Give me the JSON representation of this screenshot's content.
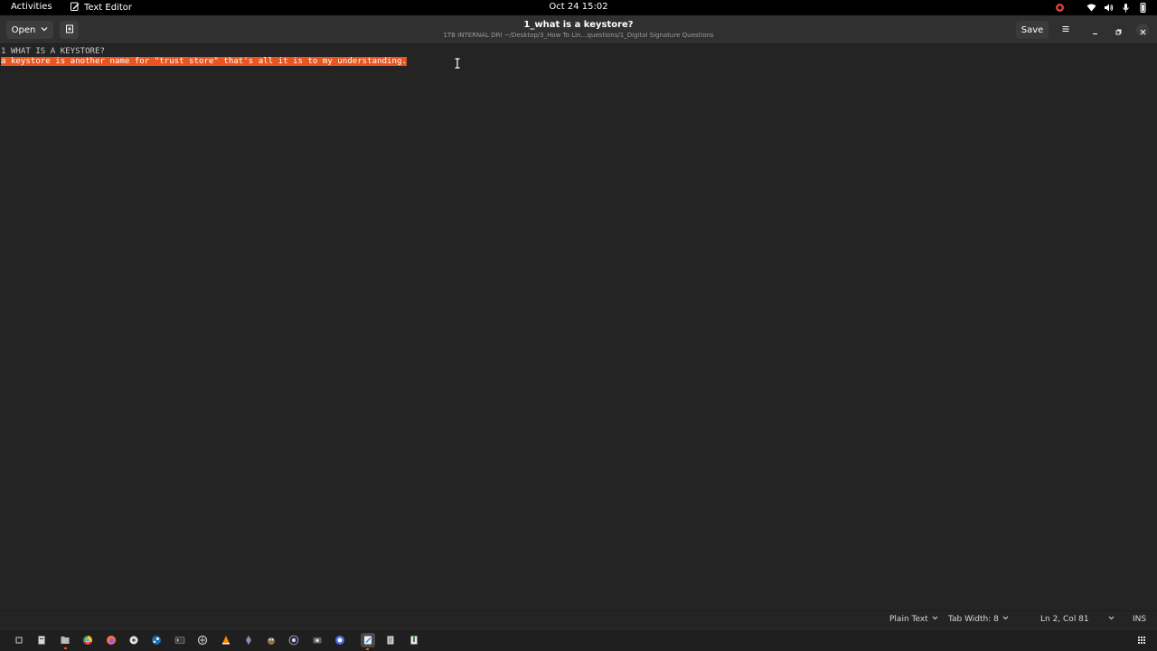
{
  "topbar": {
    "activities": "Activities",
    "app_name": "Text Editor",
    "clock": "Oct 24  15:02"
  },
  "header": {
    "open_label": "Open",
    "title": "1_what is a keystore?",
    "path": "1TB INTERNAL DRI ~/Desktop/3_How To Lin…questions/1_Digital Signature Questions",
    "save_label": "Save"
  },
  "editor": {
    "line1": "1 WHAT IS A KEYSTORE?",
    "line2_selected": "a keystore is another name for \"trust store\" that's all it is to my understanding.",
    "selection_color": "#e95420"
  },
  "statusbar": {
    "language": "Plain Text",
    "tab_width": "Tab Width: 8",
    "position": "Ln 2, Col 81",
    "insert_mode": "INS"
  },
  "colors": {
    "accent": "#e95420",
    "background": "#242424",
    "headerbar": "#303030"
  }
}
